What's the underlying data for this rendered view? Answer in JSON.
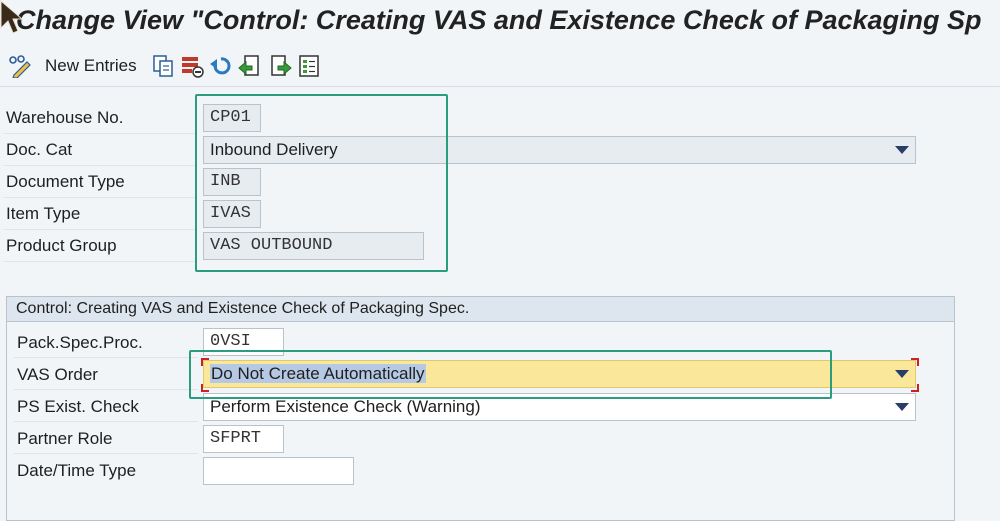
{
  "window": {
    "title": "Change View \"Control: Creating VAS and Existence Check of Packaging Sp"
  },
  "toolbar": {
    "new_entries_label": "New Entries",
    "icons": [
      "change-display-icon",
      "copy-icon",
      "delete-icon",
      "undo-icon",
      "previous-entry-icon",
      "next-entry-icon",
      "select-all-icon"
    ]
  },
  "header_fields": {
    "warehouse_no": {
      "label": "Warehouse No.",
      "value": "CP01"
    },
    "doc_cat": {
      "label": "Doc. Cat",
      "value": "Inbound Delivery"
    },
    "document_type": {
      "label": "Document Type",
      "value": "INB"
    },
    "item_type": {
      "label": "Item Type",
      "value": "IVAS"
    },
    "product_group": {
      "label": "Product Group",
      "value": "VAS OUTBOUND"
    }
  },
  "control_group": {
    "title": "Control: Creating VAS and Existence Check of Packaging Spec.",
    "pack_spec_proc": {
      "label": "Pack.Spec.Proc.",
      "value": "0VSI"
    },
    "vas_order": {
      "label": "VAS Order",
      "value": "Do Not Create Automatically"
    },
    "ps_exist_check": {
      "label": "PS Exist. Check",
      "value": "Perform Existence Check (Warning)"
    },
    "partner_role": {
      "label": "Partner Role",
      "value": "SFPRT"
    },
    "date_time_type": {
      "label": "Date/Time Type",
      "value": ""
    }
  },
  "colors": {
    "highlight_box": "#2a9d7f",
    "focused_field": "#fbe79a",
    "readonly_field": "#e7ecf0",
    "dropdown_arrow": "#2a3d6a"
  }
}
